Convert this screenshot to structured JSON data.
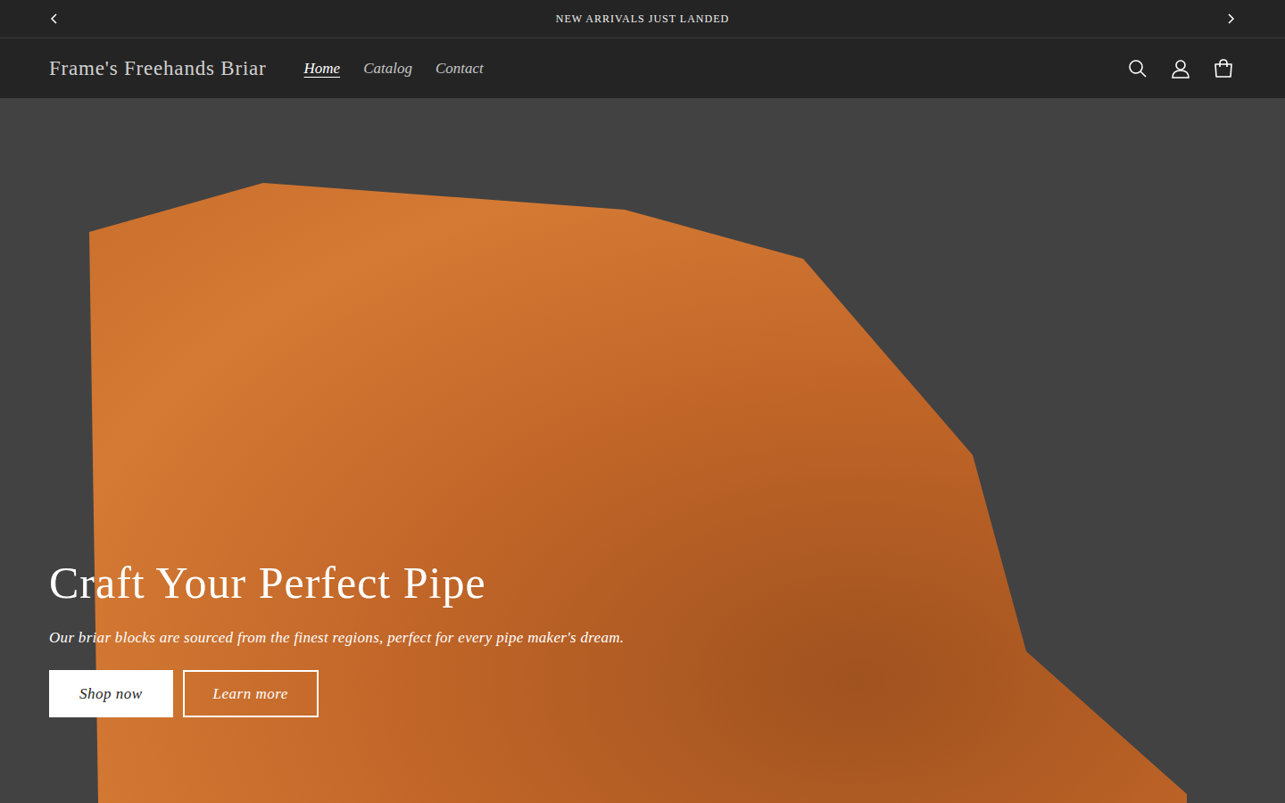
{
  "announcement": {
    "text": "NEW ARRIVALS JUST LANDED"
  },
  "header": {
    "logo": "Frame's Freehands Briar",
    "nav": [
      {
        "label": "Home",
        "selected": true
      },
      {
        "label": "Catalog",
        "selected": false
      },
      {
        "label": "Contact",
        "selected": false
      }
    ]
  },
  "hero": {
    "heading": "Craft Your Perfect Pipe",
    "subheading": "Our briar blocks are sourced from the finest regions, perfect for every pipe maker's dream.",
    "buttons": [
      {
        "label": "Shop now",
        "kind": "primary"
      },
      {
        "label": "Learn more",
        "kind": "secondary"
      }
    ]
  }
}
